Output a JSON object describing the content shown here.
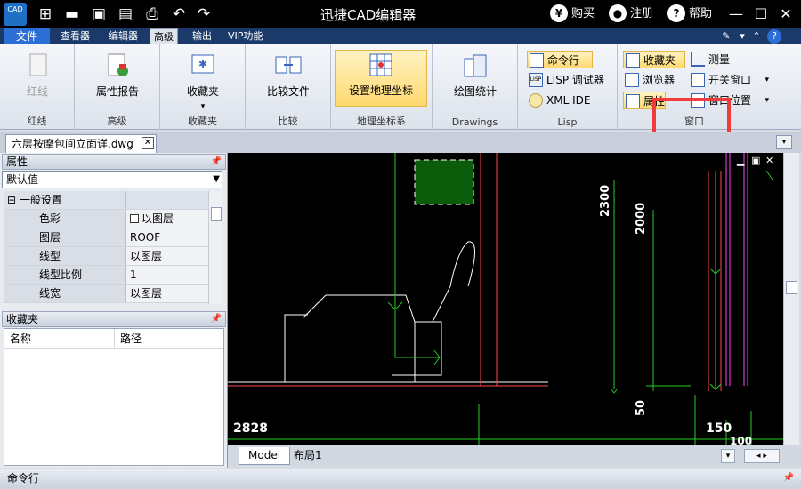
{
  "app": {
    "title": "迅捷CAD编辑器",
    "logo_text": "CAD"
  },
  "title_actions": {
    "buy": "购买",
    "register": "注册",
    "help": "帮助"
  },
  "menubar": {
    "file": "文件",
    "tabs": [
      "查看器",
      "编辑器",
      "高级",
      "输出",
      "VIP功能"
    ],
    "active": "高级"
  },
  "ribbon": {
    "groups": {
      "redline": {
        "label": "红线",
        "button": "红线"
      },
      "advanced": {
        "label": "高级",
        "button": "属性报告"
      },
      "favorites": {
        "label": "收藏夹",
        "button": "收藏夹"
      },
      "compare": {
        "label": "比较",
        "button": "比较文件"
      },
      "geo": {
        "label": "地理坐标系",
        "button": "设置地理坐标"
      },
      "drawings": {
        "label": "Drawings",
        "button": "绘图统计"
      },
      "lisp": {
        "label": "Lisp",
        "cmd": "命令行",
        "debugger": "LISP 调试器",
        "xml": "XML IDE"
      },
      "window": {
        "label": "窗口",
        "favorites": "收藏夹",
        "browser": "浏览器",
        "properties": "属性",
        "measure": "测量",
        "toggle_windows": "开关窗口",
        "window_position": "窗口位置"
      }
    }
  },
  "document_tab": {
    "name": "六层按摩包间立面详.dwg"
  },
  "properties_panel": {
    "title": "属性",
    "selected": "默认值",
    "section": "一般设置",
    "rows": [
      {
        "key": "色彩",
        "value": "以图层"
      },
      {
        "key": "图层",
        "value": "ROOF"
      },
      {
        "key": "线型",
        "value": "以图层"
      },
      {
        "key": "线型比例",
        "value": "1"
      },
      {
        "key": "线宽",
        "value": "以图层"
      }
    ]
  },
  "favorites_panel": {
    "title": "收藏夹",
    "columns": [
      "名称",
      "路径"
    ]
  },
  "canvas": {
    "dims": [
      "2300",
      "2000",
      "50",
      "2828",
      "150",
      "100"
    ]
  },
  "layout_tabs": [
    "Model",
    "布局1"
  ],
  "command_bar": {
    "label": "命令行"
  },
  "colors": {
    "accent": "#2b6fd6",
    "canvas_bg": "#000000",
    "dim_green": "#22cc22",
    "highlight_red": "#f03c3c"
  }
}
